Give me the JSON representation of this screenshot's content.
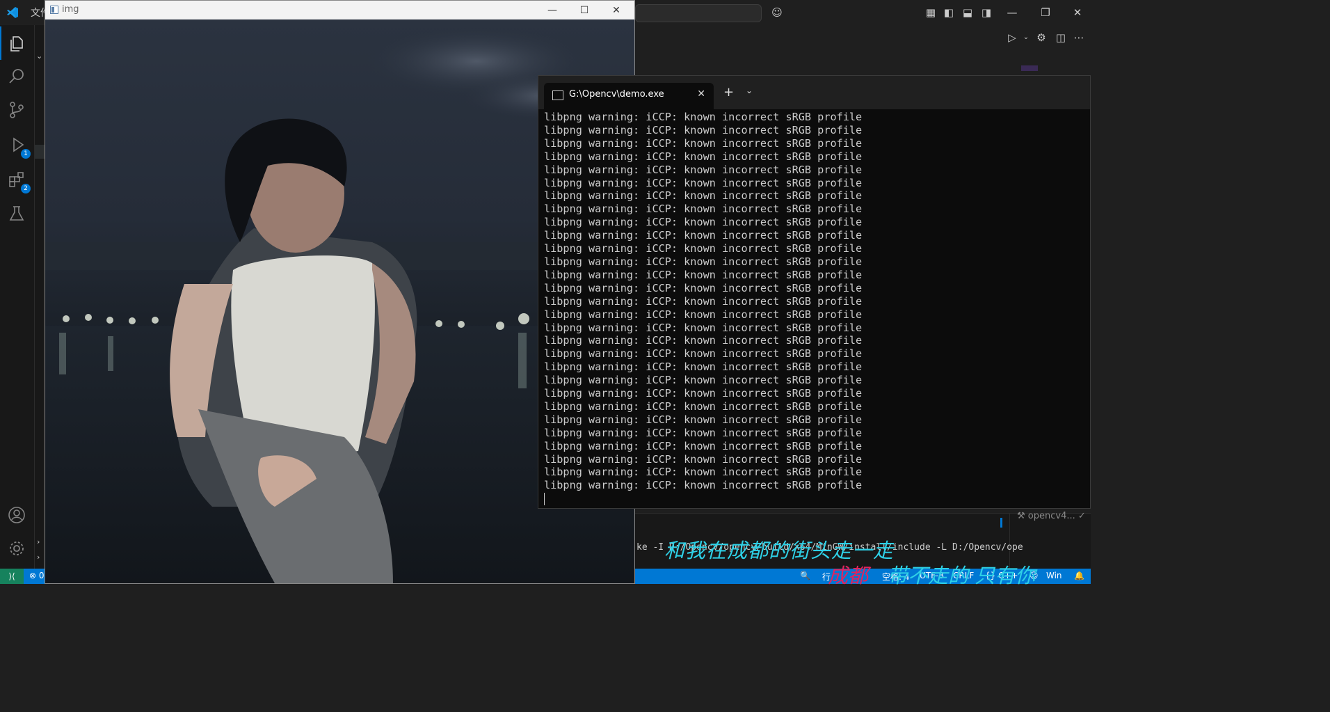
{
  "vscode": {
    "menu_first": "文件",
    "activity": [
      {
        "name": "explorer",
        "badge": ""
      },
      {
        "name": "search",
        "badge": ""
      },
      {
        "name": "source-control",
        "badge": ""
      },
      {
        "name": "run-debug",
        "badge": "1"
      },
      {
        "name": "extensions",
        "badge": "2"
      },
      {
        "name": "testing",
        "badge": ""
      }
    ],
    "panel": {
      "command": "ke -I D:/Opencv/opencv/build/x64/MinGW/install/include -L D:/Opencv/ope",
      "task": "opencv4..."
    },
    "statusbar": {
      "errors": "⊗ 0",
      "zoom": "🔍",
      "position": "行 ",
      "spaces": "空格: 4",
      "encoding": "UTF-8",
      "eol": "CRLF",
      "language": "{} C++",
      "os": "Win"
    }
  },
  "image_window": {
    "title": "img",
    "minimize": "—",
    "maximize": "☐",
    "close": "✕"
  },
  "terminal": {
    "tab_title": "G:\\Opencv\\demo.exe",
    "tab_close": "✕",
    "new_tab": "+",
    "dropdown": "⌄",
    "warning_line": "libpng warning: iCCP: known incorrect sRGB profile",
    "warning_count": 29
  },
  "overlay": {
    "lyric_line1": "和我在成都的街头走一走",
    "lyric_line2a": "成都",
    "lyric_line2b": "带不走的 只有你"
  }
}
